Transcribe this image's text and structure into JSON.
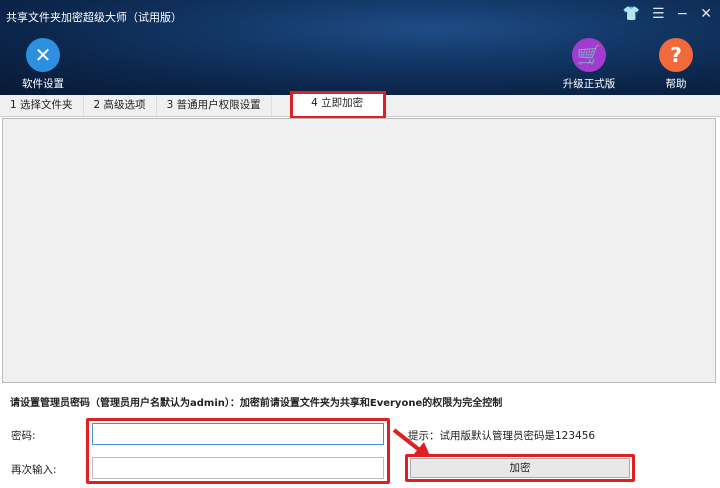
{
  "window": {
    "title": "共享文件夹加密超级大师（试用版）"
  },
  "toolbar": {
    "settings": "软件设置",
    "upgrade": "升级正式版",
    "help": "帮助"
  },
  "tabs": [
    "1 选择文件夹",
    "2 高级选项",
    "3 普通用户权限设置",
    "4 立即加密"
  ],
  "form": {
    "note": "请设置管理员密码（管理员用户名默认为admin）：加密前请设置文件夹为共享和Everyone的权限为完全控制",
    "password_label": "密码:",
    "confirm_label": "再次输入:",
    "password_value": "",
    "confirm_value": "",
    "hint": "提示：试用版默认管理员密码是123456",
    "encrypt_button": "加密"
  },
  "colors": {
    "highlight": "#e02020",
    "header": "#123766"
  }
}
